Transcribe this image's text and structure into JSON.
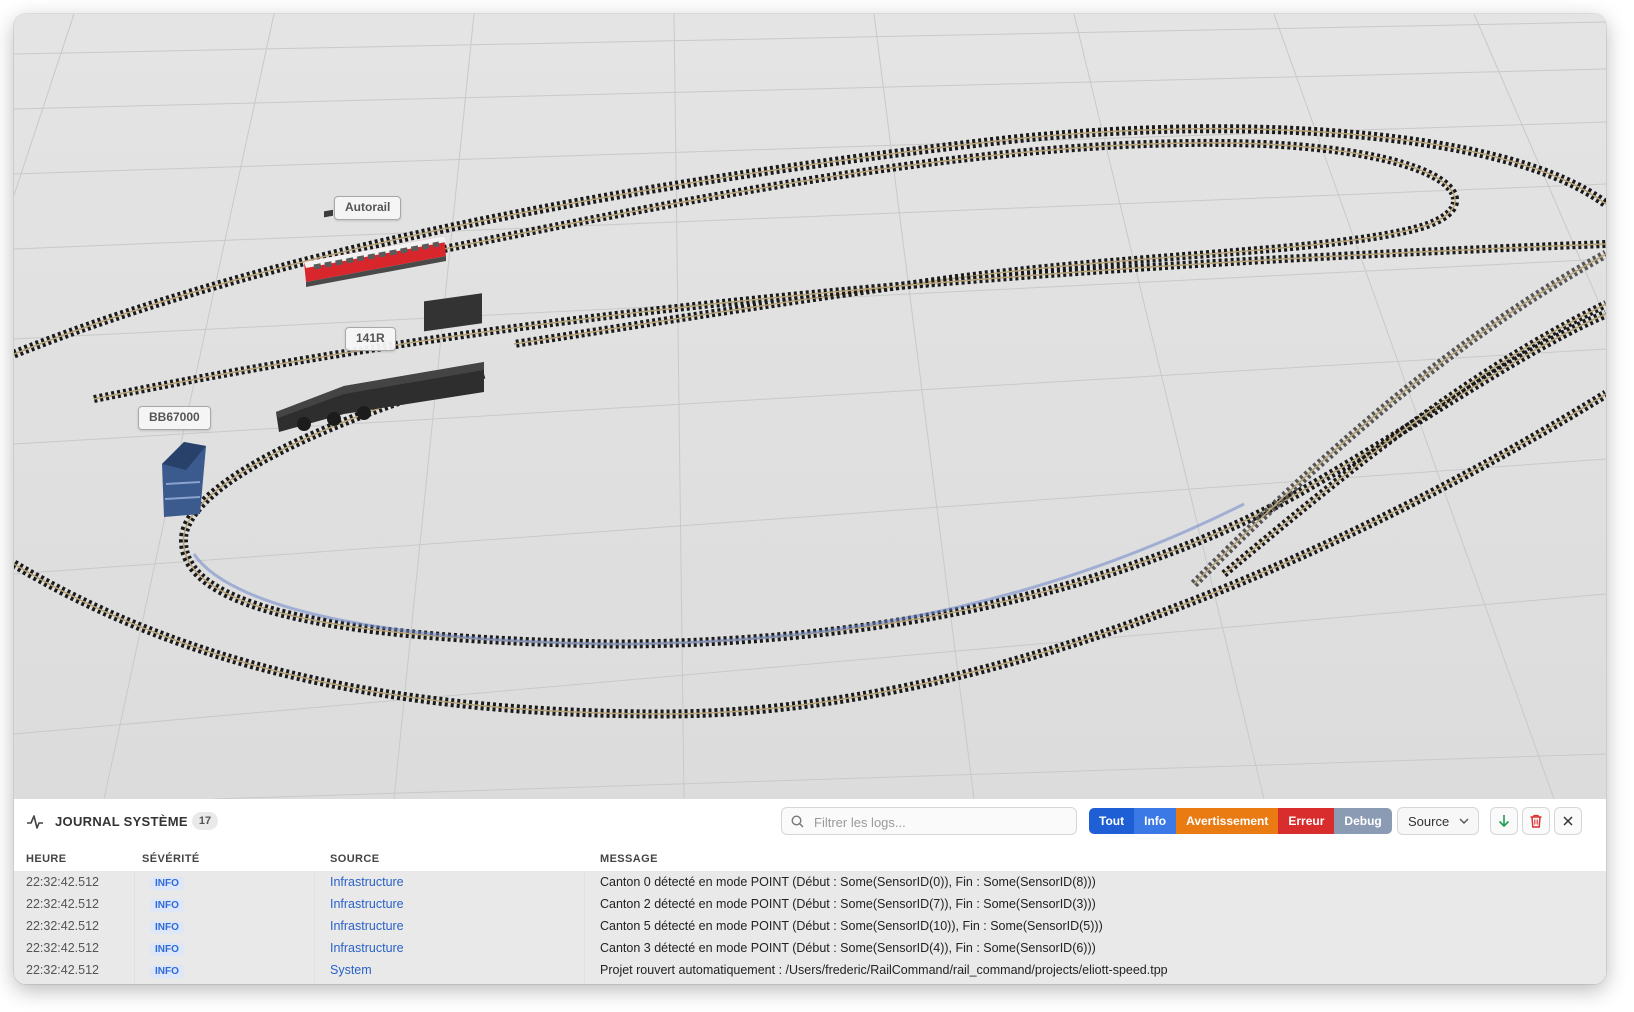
{
  "scene": {
    "trains": [
      {
        "name": "Autorail",
        "color": "#d8262c"
      },
      {
        "name": "141R",
        "color": "#2e2e2e"
      },
      {
        "name": "BB67000",
        "color": "#3b5a8e"
      }
    ]
  },
  "log_panel": {
    "icon": "activity-icon",
    "title": "JOURNAL SYSTÈME",
    "count": "17",
    "search": {
      "placeholder": "Filtrer les logs...",
      "value": ""
    },
    "filters": [
      {
        "label": "Tout",
        "color": "#1e5fd6"
      },
      {
        "label": "Info",
        "color": "#3b79e6"
      },
      {
        "label": "Avertissement",
        "color": "#e97b12"
      },
      {
        "label": "Erreur",
        "color": "#d92c2c"
      },
      {
        "label": "Debug",
        "color": "#8b9bb4"
      }
    ],
    "source_select": {
      "label": "Source",
      "icon": "chevron-down-icon"
    },
    "actions": [
      {
        "name": "scroll-down-button",
        "icon": "arrow-down-icon",
        "color": "#1f9d55"
      },
      {
        "name": "clear-logs-button",
        "icon": "trash-icon",
        "color": "#d92c2c"
      },
      {
        "name": "close-panel-button",
        "icon": "close-icon",
        "color": "#333333"
      }
    ],
    "columns": [
      "HEURE",
      "SÉVÉRITÉ",
      "SOURCE",
      "MESSAGE"
    ],
    "rows": [
      {
        "time": "22:32:42.512",
        "severity": "INFO",
        "source": "Infrastructure",
        "message": "Canton 0 détecté en mode POINT (Début : Some(SensorID(0)), Fin : Some(SensorID(8)))"
      },
      {
        "time": "22:32:42.512",
        "severity": "INFO",
        "source": "Infrastructure",
        "message": "Canton 2 détecté en mode POINT (Début : Some(SensorID(7)), Fin : Some(SensorID(3)))"
      },
      {
        "time": "22:32:42.512",
        "severity": "INFO",
        "source": "Infrastructure",
        "message": "Canton 5 détecté en mode POINT (Début : Some(SensorID(10)), Fin : Some(SensorID(5)))"
      },
      {
        "time": "22:32:42.512",
        "severity": "INFO",
        "source": "Infrastructure",
        "message": "Canton 3 détecté en mode POINT (Début : Some(SensorID(4)), Fin : Some(SensorID(6)))"
      },
      {
        "time": "22:32:42.512",
        "severity": "INFO",
        "source": "System",
        "message": "Projet rouvert automatiquement : /Users/frederic/RailCommand/rail_command/projects/eliott-speed.tpp"
      }
    ]
  }
}
